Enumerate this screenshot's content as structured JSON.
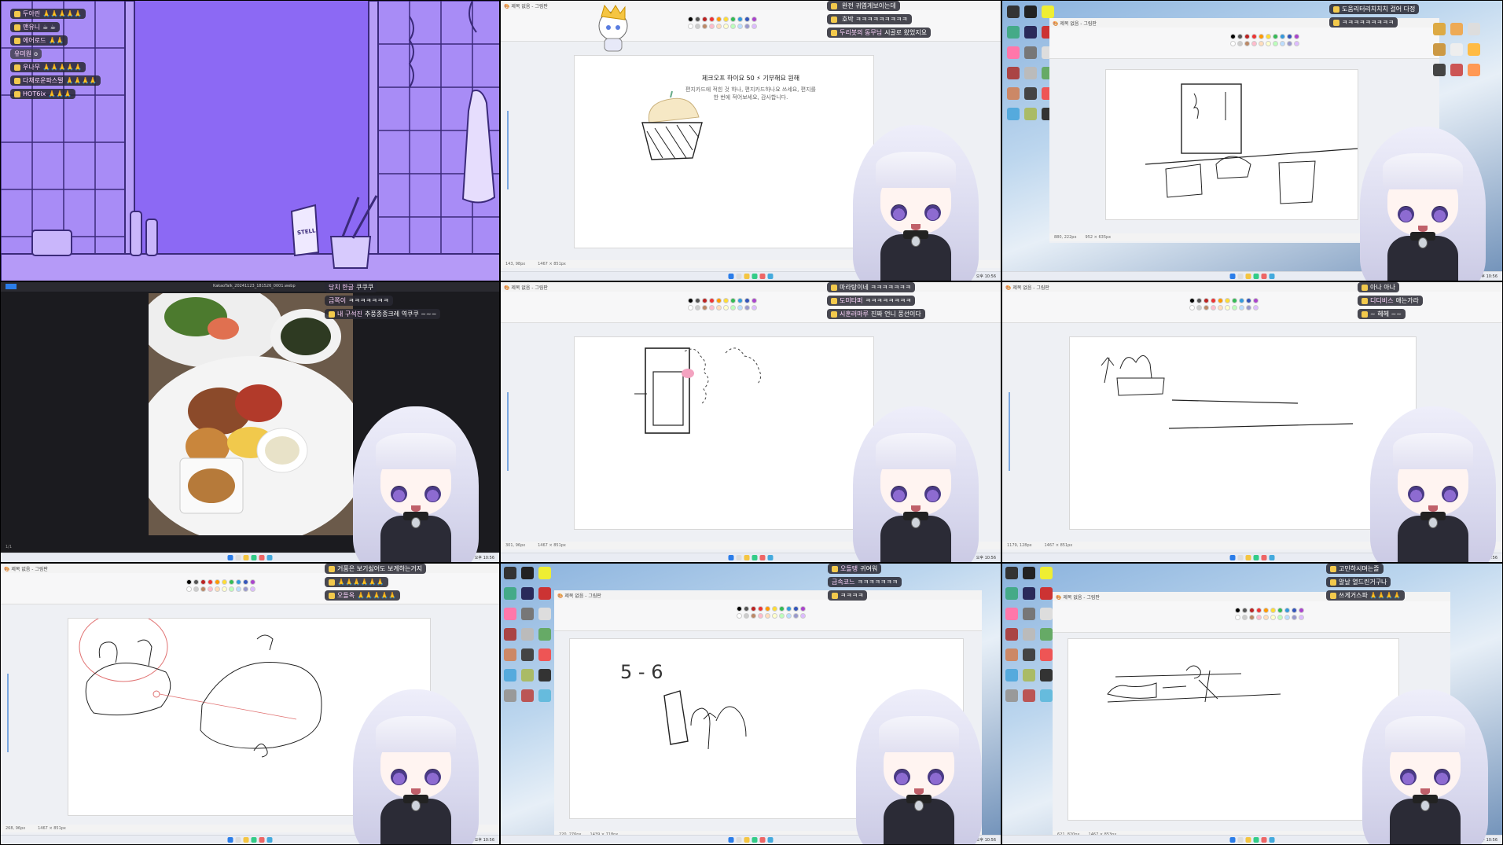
{
  "cells": [
    {
      "id": "bathroom",
      "chat": [
        {
          "name": "두아린",
          "text": "🙏🙏🙏🙏🙏"
        },
        {
          "name": "맨유니",
          "text": "☕ ☕"
        },
        {
          "name": "에어로드",
          "text": "🙏🙏"
        },
        {
          "name": "유미원",
          "text": "o"
        },
        {
          "name": "우나무",
          "text": "🙏🙏🙏🙏🙏"
        },
        {
          "name": "다채로운파스텔",
          "text": "🙏🙏🙏🙏"
        },
        {
          "name": "HOT6ix",
          "text": "🙏🙏🙏"
        }
      ],
      "bottle_label": "STELL"
    },
    {
      "id": "paint-pumpkin",
      "chat": [
        {
          "name": "",
          "text": "완전 귀엽게보이는데"
        },
        {
          "name": "",
          "text": "호박 ㅋㅋㅋㅋㅋㅋㅋㅋㅋ"
        },
        {
          "name": "두리봇의 동무님",
          "text": "시골로 왔었지요"
        }
      ],
      "caption_top": "체크오프 하이요 50 ⚡ 기부해요 원해",
      "caption_lines": [
        "편지카드에 적힌 것 하나, 편지카드하나요 쓰세요, 편지를",
        "한 번에 적어보세요, 감사합니다."
      ],
      "status_left": "143, 98px",
      "status_mid": "1467 × 851px"
    },
    {
      "id": "desktop-fridge",
      "chat": [
        {
          "name": "",
          "text": "도움리터리치치치 걸어 다정"
        },
        {
          "name": "",
          "text": "ㅋㅋㅋㅋㅋㅋㅋㅋㅋ"
        }
      ],
      "status_left": "880, 222px",
      "status_mid": "952 × 635px"
    },
    {
      "id": "food-photo",
      "chat": [
        {
          "name": "당치 한글",
          "text": "쿠쿠쿠"
        },
        {
          "name": "금쪽이",
          "text": "ㅋㅋㅋㅋㅋㅋㅋ"
        },
        {
          "name": "내 구석진",
          "text": "추풍종종크레 역쿠쿠 ~~~"
        }
      ],
      "window_title": "KakaoTalk_20241123_181526_0001.webp",
      "status_left": "1/1"
    },
    {
      "id": "paint-shower",
      "chat": [
        {
          "name": "",
          "text": "마라탕이네 ㅋㅋㅋㅋㅋㅋㅋ"
        },
        {
          "name": "도미타퍼",
          "text": "ㅋㅋㅋㅋㅋㅋㅋㅋ"
        },
        {
          "name": "시훈러마루",
          "text": "진짜 언니 풍선이다"
        }
      ],
      "status_left": "301, 96px",
      "status_mid": "1467 × 851px"
    },
    {
      "id": "paint-sink",
      "chat": [
        {
          "name": "",
          "text": "아나 아나"
        },
        {
          "name": "디디비스",
          "text": "애는가라"
        },
        {
          "name": "",
          "text": "~ 헤헤 ~~"
        }
      ],
      "status_left": "1179, 128px",
      "status_mid": "1467 × 851px"
    },
    {
      "id": "paint-bath",
      "chat": [
        {
          "name": "",
          "text": "거품은 보기싫어도 보게하는거지"
        },
        {
          "name": "",
          "text": "🙏🙏🙏🙏🙏🙏"
        },
        {
          "name": "오돌옥",
          "text": "🙏🙏🙏🙏🙏"
        }
      ],
      "status_left": "268, 96px",
      "status_mid": "1467 × 851px"
    },
    {
      "id": "desktop-paint-56",
      "chat": [
        {
          "name": "오돌탱",
          "text": "귀여워"
        },
        {
          "name": "금속코느",
          "text": "ㅋㅋㅋㅋㅋㅋㅋ"
        },
        {
          "name": "",
          "text": "ㅋㅋㅋㅋ"
        }
      ],
      "canvas_text": "5 - 6",
      "status_left": "220, 276px",
      "status_mid": "1439 × 718px"
    },
    {
      "id": "desktop-paint-bed",
      "chat": [
        {
          "name": "",
          "text": "고민하시며는즐"
        },
        {
          "name": "",
          "text": "알날 열드린거구나"
        },
        {
          "name": "",
          "text": "쓰게거스파 🙏🙏🙏🙏"
        }
      ],
      "status_left": "621, 820px",
      "status_mid": "1467 × 853px"
    }
  ],
  "clock": {
    "time": "오후 10:56",
    "date": "2024-11-26"
  },
  "colors": {
    "bathroom_bg": "#8c69f4",
    "bathroom_line": "#3b2a7a",
    "paint_bg": "#eef0f4",
    "canvas": "#ffffff"
  },
  "icons": [
    "search-icon",
    "windows-start-icon",
    "folder-icon",
    "browser-icon",
    "paint-icon",
    "chat-icon"
  ]
}
